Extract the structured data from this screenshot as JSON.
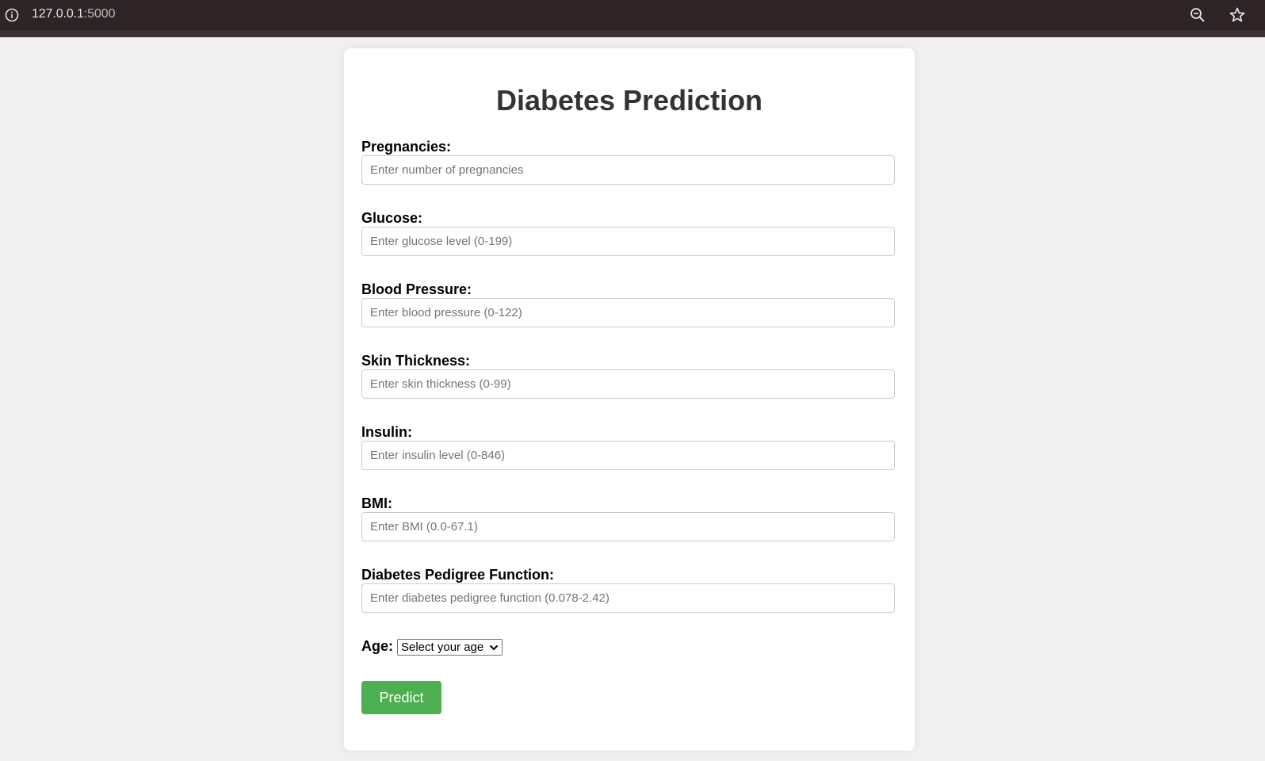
{
  "browser": {
    "url_host": "127.0.0.1",
    "url_port": ":5000"
  },
  "form": {
    "title": "Diabetes Prediction",
    "fields": [
      {
        "label": "Pregnancies:",
        "placeholder": "Enter number of pregnancies"
      },
      {
        "label": "Glucose:",
        "placeholder": "Enter glucose level (0-199)"
      },
      {
        "label": "Blood Pressure:",
        "placeholder": "Enter blood pressure (0-122)"
      },
      {
        "label": "Skin Thickness:",
        "placeholder": "Enter skin thickness (0-99)"
      },
      {
        "label": "Insulin:",
        "placeholder": "Enter insulin level (0-846)"
      },
      {
        "label": "BMI:",
        "placeholder": "Enter BMI (0.0-67.1)"
      },
      {
        "label": "Diabetes Pedigree Function:",
        "placeholder": "Enter diabetes pedigree function (0.078-2.42)"
      }
    ],
    "age": {
      "label": "Age:",
      "selected": "Select your age"
    },
    "submit_label": "Predict"
  },
  "colors": {
    "browser_bar": "#2e2325",
    "page_bg": "#f0f0f0",
    "button_bg": "#4caf50"
  },
  "icons": {
    "site_info": "info-icon",
    "zoom": "zoom-icon",
    "bookmark": "star-icon",
    "select_arrow": "chevron-down-icon"
  }
}
